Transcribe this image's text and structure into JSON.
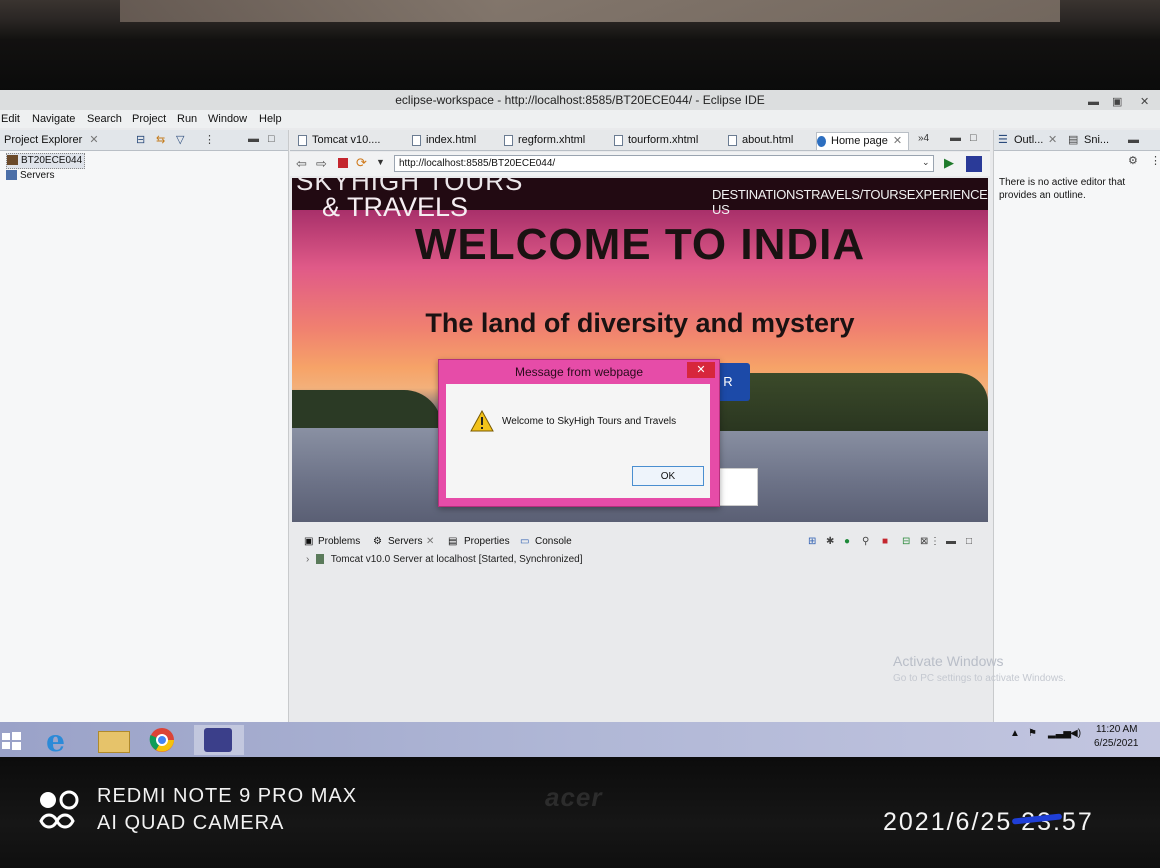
{
  "window": {
    "title": "eclipse-workspace - http://localhost:8585/BT20ECE044/ - Eclipse IDE"
  },
  "menu": [
    "Edit",
    "Navigate",
    "Search",
    "Project",
    "Run",
    "Window",
    "Help"
  ],
  "project_explorer": {
    "tab_label": "Project Explorer",
    "items": [
      "BT20ECE044",
      "Servers"
    ]
  },
  "editor_tabs": [
    {
      "label": "Tomcat v10...."
    },
    {
      "label": "index.html"
    },
    {
      "label": "regform.xhtml"
    },
    {
      "label": "tourform.xhtml"
    },
    {
      "label": "about.html"
    },
    {
      "label": "Home page",
      "active": true
    }
  ],
  "editor_overflow": "»4",
  "browser": {
    "url": "http://localhost:8585/BT20ECE044/"
  },
  "webpage": {
    "brand_line1": "SKYHIGH TOURS",
    "brand_line2": "& TRAVELS",
    "nav": "DESTINATIONSTRAVELS/TOURSEXPERIENCESCONTACT US",
    "heading": "WELCOME TO INDIA",
    "tagline": "The land of diversity and mystery",
    "button_fragment": "R"
  },
  "dialog": {
    "title": "Message from webpage",
    "close": "✕",
    "message": "Welcome to SkyHigh Tours and Travels",
    "ok": "OK"
  },
  "bottom_panel": {
    "tabs": [
      "Problems",
      "Servers",
      "Properties",
      "Console"
    ],
    "server_row": "Tomcat v10.0 Server at localhost  [Started, Synchronized]"
  },
  "outline": {
    "tab1": "Outl...",
    "tab2": "Sni...",
    "message": "There is no active editor that provides an outline."
  },
  "watermark": {
    "line1": "Activate Windows",
    "line2": "Go to PC settings to activate Windows."
  },
  "taskbar": {
    "time": "11:20 AM",
    "date": "6/25/2021"
  },
  "photo_overlay": {
    "camera_line1": "REDMI NOTE 9 PRO MAX",
    "camera_line2": "AI QUAD CAMERA",
    "timestamp": "2021/6/25 23:57",
    "monitor_brand": "acer"
  }
}
